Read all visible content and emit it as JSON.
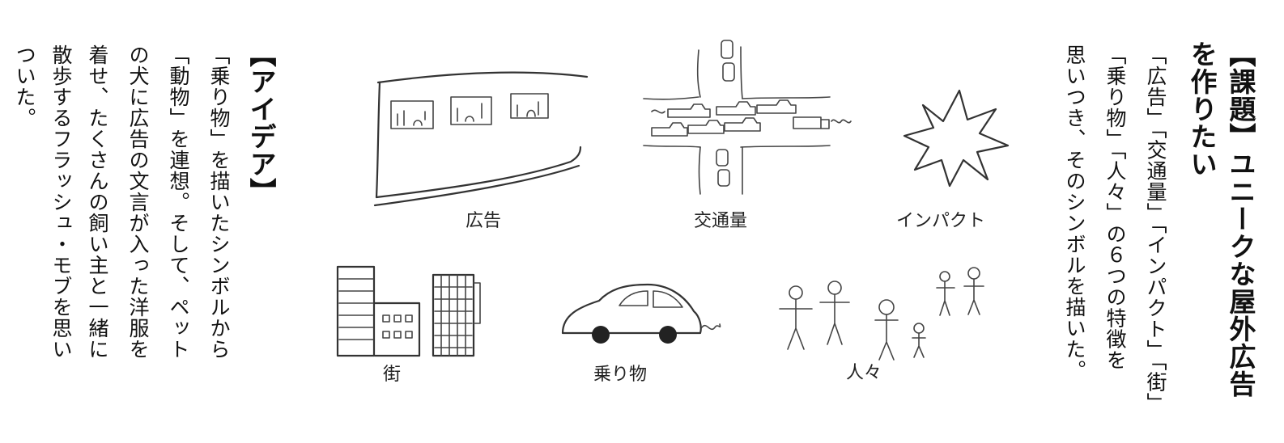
{
  "task": {
    "heading_line1": "【課題】ユニークな屋外広告",
    "heading_line2": "を作りたい",
    "body_lines": [
      "「広告」「交通量」「インパクト」「街」",
      "「乗り物」「人々」の６つの特徴を",
      "思いつき、そのシンボルを描いた。"
    ]
  },
  "idea": {
    "heading": "【アイデア】",
    "body_lines": [
      "「乗り物」を描いたシンボルから",
      "「動物」を連想。そして、ペット",
      "の犬に広告の文言が入った洋服を",
      "着せ、たくさんの飼い主と一緒に",
      "散歩するフラッシュ・モブを思い",
      "ついた。"
    ]
  },
  "sketches": {
    "captions": [
      "広告",
      "交通量",
      "インパクト",
      "街",
      "乗り物",
      "人々"
    ]
  }
}
